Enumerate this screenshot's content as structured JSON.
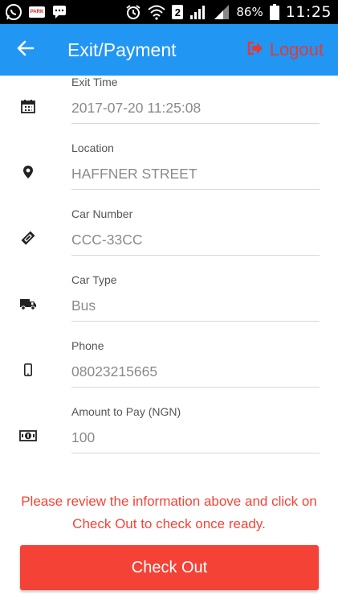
{
  "status_bar": {
    "app_badge": "PARK",
    "sim_slot": "2",
    "battery": "86%",
    "time": "11:25"
  },
  "app_bar": {
    "title": "Exit/Payment",
    "logout_label": "Logout"
  },
  "fields": [
    {
      "label": "Exit Time",
      "value": "2017-07-20 11:25:08",
      "icon": "calendar-icon"
    },
    {
      "label": "Location",
      "value": "HAFFNER STREET",
      "icon": "location-pin-icon"
    },
    {
      "label": "Car Number",
      "value": "CCC-33CC",
      "icon": "ticket-icon"
    },
    {
      "label": "Car Type",
      "value": "Bus",
      "icon": "truck-icon"
    },
    {
      "label": "Phone",
      "value": "08023215665",
      "icon": "mobile-phone-icon"
    },
    {
      "label": "Amount to Pay (NGN)",
      "value": "100",
      "icon": "money-icon"
    }
  ],
  "notice": "Please review the information above and click on Check Out to check once ready.",
  "checkout_label": "Check Out",
  "colors": {
    "primary": "#2196f3",
    "accent": "#f44336",
    "logout": "#e53935"
  }
}
